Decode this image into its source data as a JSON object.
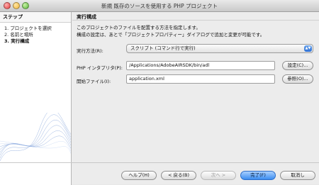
{
  "window": {
    "title": "新規 既存のソースを使用する PHP プロジェクト"
  },
  "sidebar": {
    "header": "ステップ",
    "steps": [
      {
        "number": "1.",
        "label": "プロジェクトを選択"
      },
      {
        "number": "2.",
        "label": "名前と場所"
      },
      {
        "number": "3.",
        "label": "実行構成"
      }
    ],
    "current_step_index": 2
  },
  "main": {
    "header": "実行構成",
    "description_line1": "このプロジェクトのファイルを配置する方法を指定します。",
    "description_line2": "構成の設定は、あとで「プロジェクトプロパティー」ダイアログで追加と変更が可能です。",
    "run_as": {
      "label": "実行方法(R):",
      "selected_value": "スクリプト (コマンド行で実行)"
    },
    "php_interpreter": {
      "label": "PHP インタプリタ(P):",
      "value": "/Applications/AdobeAIRSDK/bin/adl",
      "button_label": "設定(C)..."
    },
    "start_file": {
      "label": "開始ファイル(I):",
      "value": "application.xml",
      "button_label": "参照(O)..."
    }
  },
  "footer": {
    "help_label": "ヘルプ(H)",
    "back_label": "< 戻る(B)",
    "next_label": "次へ >",
    "finish_label": "完了(F)",
    "cancel_label": "取消し"
  },
  "colors": {
    "primary_button": "#3b8df0",
    "select_arrow": "#2b6fd6"
  }
}
